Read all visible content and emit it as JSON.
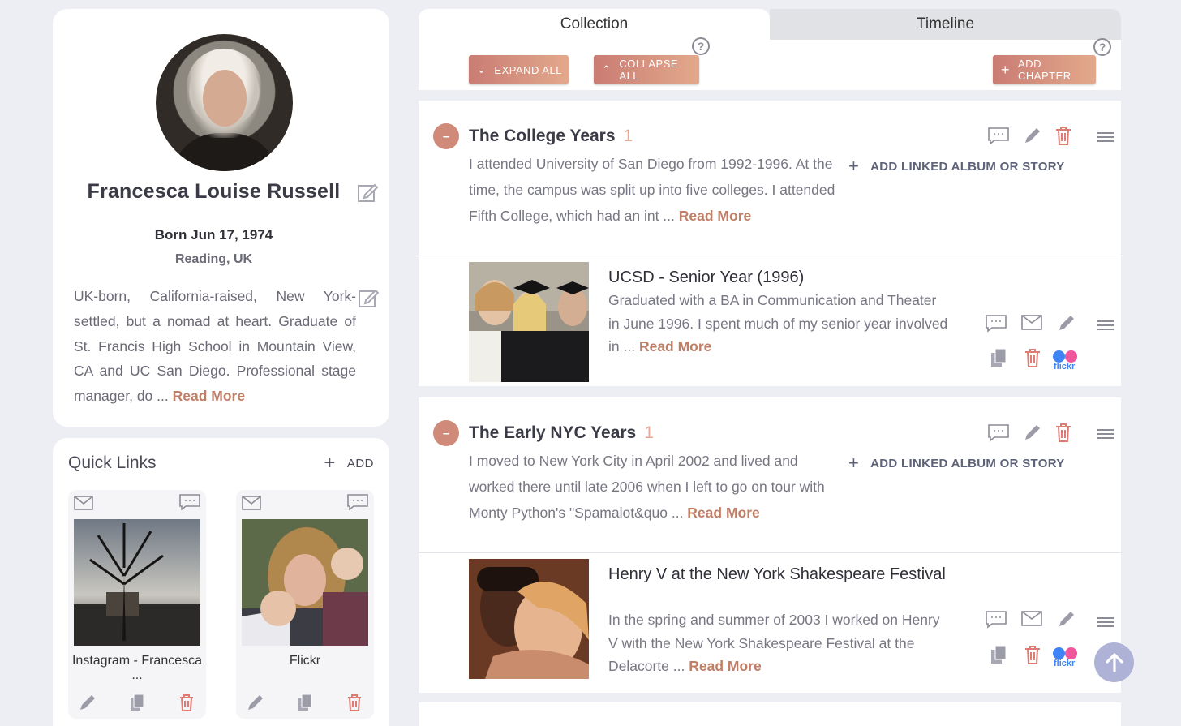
{
  "profile": {
    "name": "Francesca Louise Russell",
    "born": "Born Jun 17, 1974",
    "place": "Reading, UK",
    "bio": "UK-born, California-raised, New York-settled, but a nomad at heart. Graduate of St. Francis High School in Mountain View, CA and UC San Diego. Professional stage manager, do ...",
    "read_more": "Read More"
  },
  "quick_links": {
    "title": "Quick Links",
    "add_label": "ADD",
    "items": [
      {
        "label": "Instagram - Francesca ..."
      },
      {
        "label": "Flickr"
      }
    ]
  },
  "tabs": [
    {
      "label": "Collection",
      "active": true
    },
    {
      "label": "Timeline",
      "active": false
    }
  ],
  "toolbar": {
    "expand_all": "EXPAND ALL",
    "collapse_all": "COLLAPSE ALL",
    "add_chapter": "ADD CHAPTER",
    "help_glyph": "?"
  },
  "chapters": [
    {
      "title": "The College Years",
      "count": "1",
      "text": "I attended University of San Diego from 1992-1996. At the time, the campus was split up into five colleges. I attended Fifth College, which had an int ...",
      "read_more": "Read More",
      "linked_label": "ADD LINKED ALBUM OR STORY",
      "story": {
        "title": "UCSD - Senior Year (1996)",
        "text": "Graduated with a BA in Communication and Theater in June 1996. I spent much of my senior year involved in ...",
        "read_more": "Read More",
        "flickr_label": "flickr"
      }
    },
    {
      "title": "The Early NYC Years",
      "count": "1",
      "text": "I moved to New York City in April 2002 and lived and worked there until late 2006 when I left to go on tour with Monty Python's \"Spamalot&quo ...",
      "read_more": "Read More",
      "linked_label": "ADD LINKED ALBUM OR STORY",
      "story": {
        "title": "Henry V at the New York Shakespeare Festival",
        "text": "In the spring and summer of 2003 I worked on Henry V with the New York Shakespeare Festival at the Delacorte ...",
        "read_more": "Read More",
        "flickr_label": "flickr"
      }
    }
  ],
  "colors": {
    "accent": "#c07e66",
    "button_gradient_start": "#c97c73",
    "button_gradient_end": "#e3a98c",
    "delete_red": "#e07a72",
    "scroll_top": "#adb2d6"
  }
}
